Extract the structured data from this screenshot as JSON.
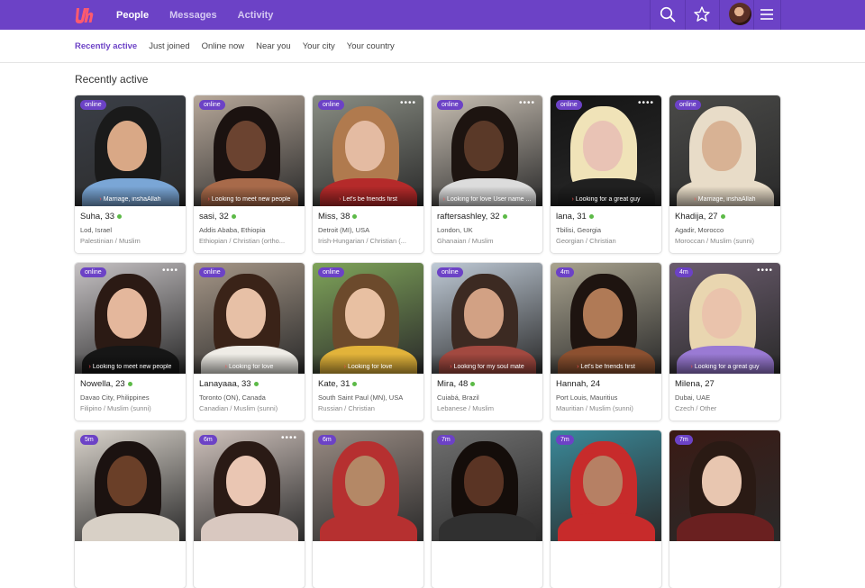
{
  "header": {
    "nav": [
      {
        "label": "People",
        "active": true
      },
      {
        "label": "Messages",
        "active": false
      },
      {
        "label": "Activity",
        "active": false
      }
    ],
    "icons": [
      "logo-icon",
      "search-icon",
      "star-icon",
      "avatar",
      "menu-icon"
    ],
    "brand_color": "#6c42c6"
  },
  "subnav": {
    "items": [
      {
        "label": "Recently active",
        "active": true
      },
      {
        "label": "Just joined",
        "active": false
      },
      {
        "label": "Online now",
        "active": false
      },
      {
        "label": "Near you",
        "active": false
      },
      {
        "label": "Your city",
        "active": false
      },
      {
        "label": "Your country",
        "active": false
      }
    ]
  },
  "section_title": "Recently active",
  "profiles": [
    {
      "badge": "online",
      "caption": "Marriage, inshaAllah",
      "name": "Suha, 33",
      "online": true,
      "location": "Lod, Israel",
      "background": "Palestinian / Muslim",
      "menu": false,
      "palette": [
        "#3b3f47",
        "#d9a886",
        "#1a1a1a",
        "#7aa6d6"
      ]
    },
    {
      "badge": "online",
      "caption": "Looking to meet new people",
      "name": "sasi, 32",
      "online": true,
      "location": "Addis Ababa, Ethiopia",
      "background": "Ethiopian / Christian (ortho...",
      "menu": false,
      "palette": [
        "#b7a89a",
        "#6b4330",
        "#1b1210",
        "#a86a4a"
      ]
    },
    {
      "badge": "online",
      "caption": "Let's be friends first",
      "name": "Miss, 38",
      "online": true,
      "location": "Detroit (MI), USA",
      "background": "Irish-Hungarian / Christian (...",
      "menu": true,
      "palette": [
        "#8a8e84",
        "#e4bba2",
        "#b07a4e",
        "#b52a2a"
      ]
    },
    {
      "badge": "online",
      "caption": "Looking for love User name ...",
      "name": "raftersashley, 32",
      "online": true,
      "location": "London, UK",
      "background": "Ghanaian / Muslim",
      "menu": true,
      "palette": [
        "#c8bfb3",
        "#5a3928",
        "#1d1410",
        "#dcdcdc"
      ]
    },
    {
      "badge": "online",
      "caption": "Looking for a great guy",
      "name": "lana, 31",
      "online": true,
      "location": "Tbilisi, Georgia",
      "background": "Georgian / Christian",
      "menu": true,
      "palette": [
        "#141414",
        "#e9c3b5",
        "#f0e3b8",
        "#202020"
      ]
    },
    {
      "badge": "online",
      "caption": "Marriage, inshaAllah",
      "name": "Khadija, 27",
      "online": true,
      "location": "Agadir, Morocco",
      "background": "Moroccan / Muslim (sunni)",
      "menu": false,
      "palette": [
        "#4a4a48",
        "#d8b294",
        "#e8dcc8",
        "#e8dcc8"
      ]
    },
    {
      "badge": "online",
      "caption": "Looking to meet new people",
      "name": "Nowella, 23",
      "online": true,
      "location": "Davao City, Philippines",
      "background": "Filipino / Muslim (sunni)",
      "menu": true,
      "palette": [
        "#c6c2c4",
        "#e4b79c",
        "#2b1a14",
        "#161616"
      ]
    },
    {
      "badge": "online",
      "caption": "Looking for love",
      "name": "Lanayaaa, 33",
      "online": true,
      "location": "Toronto (ON), Canada",
      "background": "Canadian / Muslim (sunni)",
      "menu": false,
      "palette": [
        "#a69788",
        "#e7c0a6",
        "#3a2318",
        "#efece6"
      ]
    },
    {
      "badge": "online",
      "caption": "Looking for love",
      "name": "Kate, 31",
      "online": true,
      "location": "South Saint Paul (MN), USA",
      "background": "Russian / Christian",
      "menu": false,
      "palette": [
        "#7fa45a",
        "#e8c0a2",
        "#6c4a2c",
        "#e2b33a"
      ]
    },
    {
      "badge": "online",
      "caption": "Looking for my soul mate",
      "name": "Mira, 48",
      "online": true,
      "location": "Cuiabá, Brazil",
      "background": "Lebanese / Muslim",
      "menu": false,
      "palette": [
        "#bfcad6",
        "#d2a184",
        "#3c2a22",
        "#a24940"
      ]
    },
    {
      "badge": "4m",
      "caption": "Let's be friends first",
      "name": "Hannah, 24",
      "online": false,
      "location": "Port Louis, Mauritius",
      "background": "Mauritian / Muslim (sunni)",
      "menu": false,
      "palette": [
        "#a9a38f",
        "#b07a56",
        "#1e1410",
        "#8c5030"
      ]
    },
    {
      "badge": "4m",
      "caption": "Looking for a great guy",
      "name": "Milena, 27",
      "online": false,
      "location": "Dubai, UAE",
      "background": "Czech / Other",
      "menu": true,
      "palette": [
        "#6b5c6e",
        "#eac3ac",
        "#e9d6b0",
        "#9a7ad4"
      ]
    },
    {
      "badge": "5m",
      "caption": "",
      "name": "",
      "online": false,
      "location": "",
      "background": "",
      "menu": false,
      "palette": [
        "#d9d3cb",
        "#6a3f28",
        "#1b1210",
        "#d8d0c6"
      ]
    },
    {
      "badge": "6m",
      "caption": "",
      "name": "",
      "online": false,
      "location": "",
      "background": "",
      "menu": true,
      "palette": [
        "#cfc2bc",
        "#eac6b3",
        "#2a1a15",
        "#d9c8c0"
      ]
    },
    {
      "badge": "6m",
      "caption": "",
      "name": "",
      "online": false,
      "location": "",
      "background": "",
      "menu": false,
      "palette": [
        "#9a8c84",
        "#b48866",
        "#b63030",
        "#b63030"
      ]
    },
    {
      "badge": "7m",
      "caption": "",
      "name": "",
      "online": false,
      "location": "",
      "background": "",
      "menu": false,
      "palette": [
        "#707070",
        "#5a3424",
        "#140d0a",
        "#303030"
      ]
    },
    {
      "badge": "7m",
      "caption": "",
      "name": "",
      "online": false,
      "location": "",
      "background": "",
      "menu": false,
      "palette": [
        "#3a8a9a",
        "#b68064",
        "#c72b2b",
        "#c72b2b"
      ]
    },
    {
      "badge": "7m",
      "caption": "",
      "name": "",
      "online": false,
      "location": "",
      "background": "",
      "menu": false,
      "palette": [
        "#3a1a14",
        "#e8c6b0",
        "#2a1a14",
        "#6a2020"
      ]
    }
  ]
}
